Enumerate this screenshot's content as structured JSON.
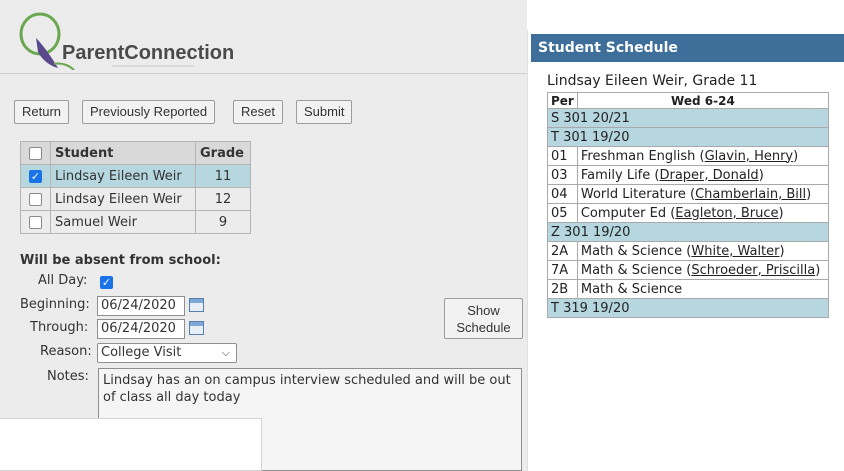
{
  "app": {
    "logo_text": "ParentConnection"
  },
  "toolbar": {
    "return_label": "Return",
    "previously_reported_label": "Previously Reported",
    "reset_label": "Reset",
    "submit_label": "Submit"
  },
  "students": {
    "headers": {
      "student": "Student",
      "grade": "Grade"
    },
    "rows": [
      {
        "name": "Lindsay Eileen Weir",
        "grade": "11",
        "checked": true
      },
      {
        "name": "Lindsay Eileen Weir",
        "grade": "12",
        "checked": false
      },
      {
        "name": "Samuel Weir",
        "grade": "9",
        "checked": false
      }
    ]
  },
  "absence": {
    "heading": "Will be absent from school:",
    "all_day_label": "All Day:",
    "all_day_checked": true,
    "beginning_label": "Beginning:",
    "beginning_value": "06/24/2020",
    "through_label": "Through:",
    "through_value": "06/24/2020",
    "reason_label": "Reason:",
    "reason_value": "College Visit",
    "notes_label": "Notes:",
    "notes_value": "Lindsay has an on campus interview scheduled and will be out of class all day today",
    "show_schedule_label_1": "Show",
    "show_schedule_label_2": "Schedule"
  },
  "schedule": {
    "header": "Student Schedule",
    "subtitle": "Lindsay Eileen Weir, Grade 11",
    "col_per": "Per",
    "col_day": "Wed 6-24",
    "rows": [
      {
        "group": true,
        "text": "S 301 20/21"
      },
      {
        "group": true,
        "text": "T 301 19/20"
      },
      {
        "per": "01",
        "course": "Freshman English (",
        "teacher": "Glavin, Henry",
        "end": ")"
      },
      {
        "per": "03",
        "course": "Family Life (",
        "teacher": "Draper, Donald",
        "end": ")"
      },
      {
        "per": "04",
        "course": "World Literature (",
        "teacher": "Chamberlain, Bill",
        "end": ")"
      },
      {
        "per": "05",
        "course": "Computer Ed (",
        "teacher": "Eagleton, Bruce",
        "end": ")"
      },
      {
        "group": true,
        "text": "Z 301 19/20"
      },
      {
        "per": "2A",
        "course": "Math & Science (",
        "teacher": "White, Walter",
        "end": ")"
      },
      {
        "per": "7A",
        "course": "Math & Science (",
        "teacher": "Schroeder, Priscilla",
        "end": ")"
      },
      {
        "per": "2B",
        "course": "Math & Science",
        "teacher": "",
        "end": ""
      },
      {
        "group": true,
        "text": "T 319 19/20"
      }
    ]
  },
  "colors": {
    "accent": "#3d6f9a",
    "highlight_row": "#b6d7df",
    "checkbox": "#1a73e8",
    "logo_green": "#6aa84f",
    "logo_purple": "#5b4a8b"
  }
}
